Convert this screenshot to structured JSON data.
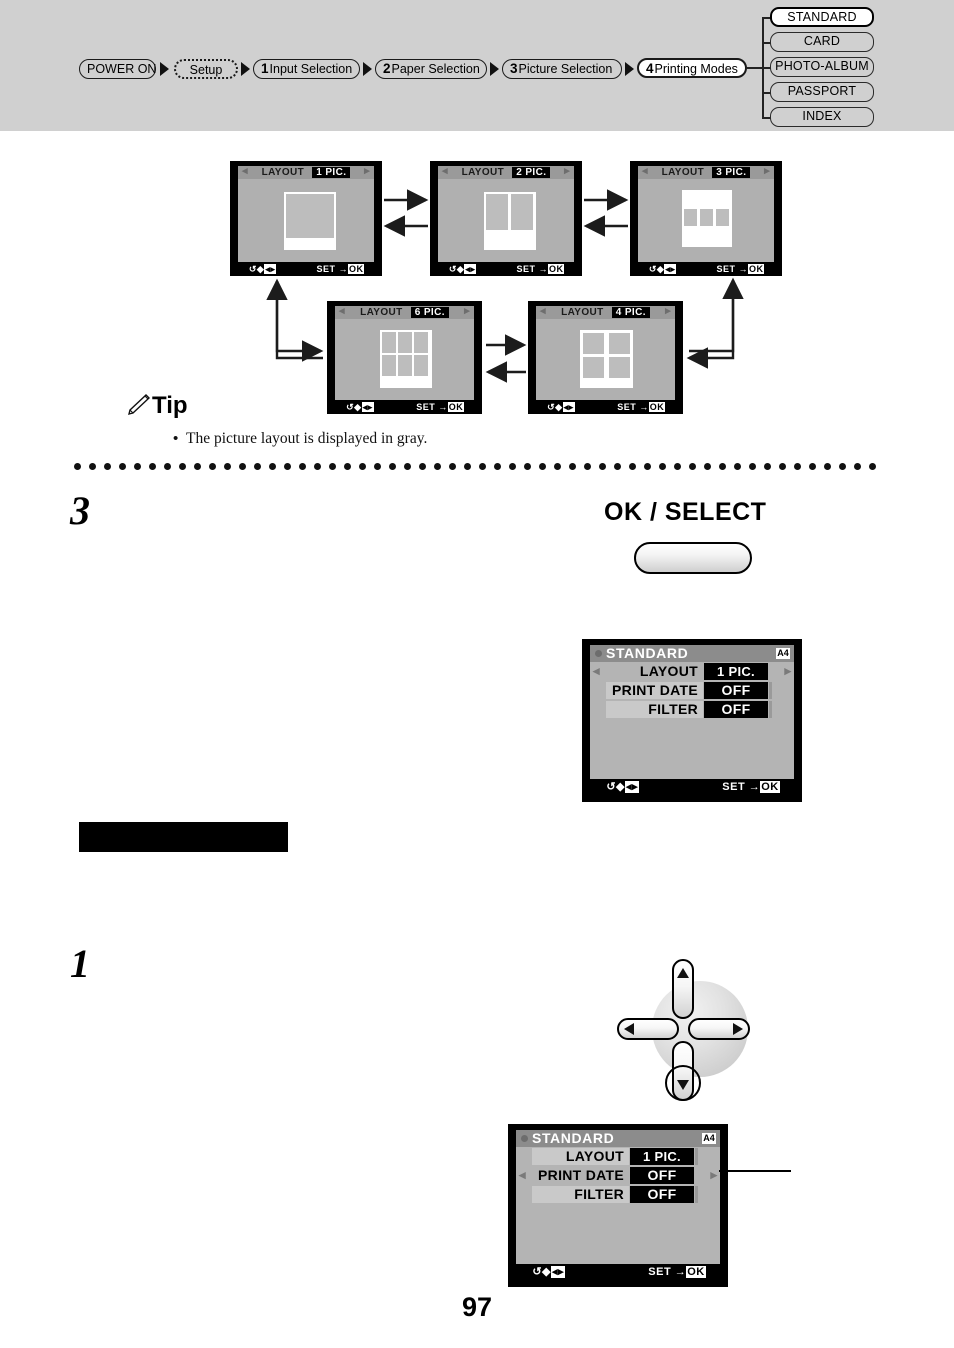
{
  "page": {
    "number": "97"
  },
  "flow": {
    "steps": [
      {
        "num": "",
        "label": "POWER ON",
        "style": "solid"
      },
      {
        "num": "",
        "label": "Setup",
        "style": "dotted"
      },
      {
        "num": "1",
        "label": "Input Selection",
        "style": "solid"
      },
      {
        "num": "2",
        "label": "Paper Selection",
        "style": "solid"
      },
      {
        "num": "3",
        "label": "Picture Selection",
        "style": "solid"
      },
      {
        "num": "4",
        "label": "Printing Modes",
        "style": "current"
      }
    ],
    "modes": [
      {
        "label": "STANDARD",
        "selected": true
      },
      {
        "label": "CARD",
        "selected": false
      },
      {
        "label": "PHOTO-ALBUM",
        "selected": false
      },
      {
        "label": "PASSPORT",
        "selected": false
      },
      {
        "label": "INDEX",
        "selected": false
      }
    ]
  },
  "layout_screens": {
    "common": {
      "title": "LAYOUT",
      "left_arrow": "◂",
      "right_arrow": "▸",
      "footer_left": "↺ →",
      "footer_left_keys": "◂▸",
      "footer_right": "SET →",
      "footer_right_key": "OK"
    },
    "items": [
      {
        "value": "1 PIC.",
        "cols": 1,
        "rows": 1
      },
      {
        "value": "2 PIC.",
        "cols": 2,
        "rows": 1
      },
      {
        "value": "3 PIC.",
        "cols": 3,
        "rows": 1
      },
      {
        "value": "6 PIC.",
        "cols": 3,
        "rows": 2
      },
      {
        "value": "4 PIC.",
        "cols": 2,
        "rows": 2
      }
    ]
  },
  "tip": {
    "heading": "Tip",
    "bullet": "•",
    "text": "The picture layout is displayed in gray."
  },
  "steps": {
    "step3": "3",
    "step1": "1"
  },
  "ok_button": {
    "label": "OK / SELECT"
  },
  "menu_screen_top": {
    "title": "STANDARD",
    "paper_icon": "A4",
    "rows": [
      {
        "label": "LAYOUT",
        "value": "1 PIC.",
        "selected": true
      },
      {
        "label": "PRINT DATE",
        "value": "OFF",
        "selected": false
      },
      {
        "label": "FILTER",
        "value": "OFF",
        "selected": false
      }
    ],
    "footer_left_keys": "◂▸",
    "footer_right": "SET →",
    "footer_right_key": "OK"
  },
  "menu_screen_bottom": {
    "title": "STANDARD",
    "paper_icon": "A4",
    "rows": [
      {
        "label": "LAYOUT",
        "value": "1 PIC.",
        "selected": false
      },
      {
        "label": "PRINT DATE",
        "value": "OFF",
        "selected": true
      },
      {
        "label": "FILTER",
        "value": "OFF",
        "selected": false
      }
    ],
    "footer_left_keys": "◂▸",
    "footer_right": "SET →",
    "footer_right_key": "OK"
  },
  "dpad": {
    "up": "▲",
    "down": "▼",
    "left": "◀",
    "right": "▶",
    "highlighted": "down"
  },
  "colors": {
    "header_bg": "#d0d0d0",
    "lcd_bezel": "#000000",
    "lcd_face": "#b0b0b0",
    "menu_value_bg": "#000000",
    "paper_white": "#ffffff",
    "cell_gray": "#bdbdbd"
  }
}
